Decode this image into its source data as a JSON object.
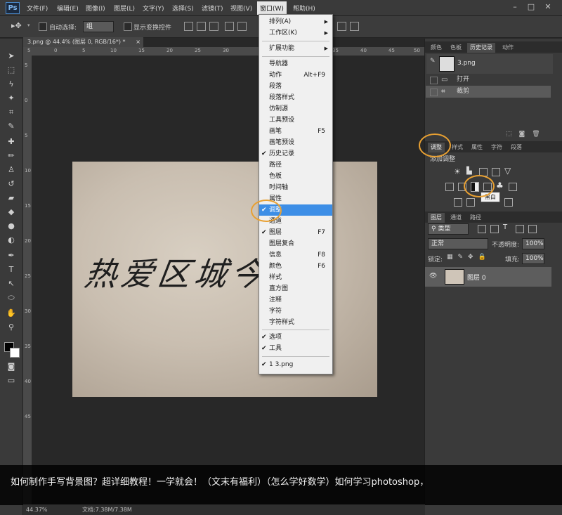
{
  "app": {
    "logo": "Ps"
  },
  "menubar": {
    "items": [
      "文件(F)",
      "编辑(E)",
      "图像(I)",
      "图层(L)",
      "文字(Y)",
      "选择(S)",
      "滤镜(T)",
      "视图(V)",
      "窗口(W)",
      "帮助(H)"
    ],
    "window_controls": [
      "–",
      "□",
      "✕"
    ]
  },
  "options": {
    "auto_select_label": "自动选择:",
    "auto_select_value": "组",
    "show_transform_label": "显示变换控件"
  },
  "document": {
    "tab_title": "3.png @ 44.4% (图层 0, RGB/16*) *",
    "tab_close": "×",
    "zoom": "44.37%",
    "doc_size": "文档:7.38M/7.38M",
    "ruler_h": [
      "5",
      "0",
      "5",
      "10",
      "15",
      "20",
      "25",
      "30",
      "35",
      "40",
      "45",
      "50"
    ],
    "ruler_v": [
      "5",
      "0",
      "5",
      "10",
      "15",
      "20",
      "25",
      "30",
      "35",
      "40",
      "45"
    ]
  },
  "window_menu": {
    "items": [
      {
        "label": "排列(A)",
        "submenu": true
      },
      {
        "label": "工作区(K)",
        "submenu": true
      },
      {
        "sep": true
      },
      {
        "label": "扩展功能",
        "submenu": true
      },
      {
        "sep": true
      },
      {
        "label": "导航器"
      },
      {
        "label": "动作",
        "shortcut": "Alt+F9"
      },
      {
        "label": "段落"
      },
      {
        "label": "段落样式"
      },
      {
        "label": "仿制源"
      },
      {
        "label": "工具预设"
      },
      {
        "label": "画笔",
        "shortcut": "F5"
      },
      {
        "label": "画笔预设"
      },
      {
        "label": "历史记录",
        "checked": true
      },
      {
        "label": "路径"
      },
      {
        "label": "色板"
      },
      {
        "label": "时间轴"
      },
      {
        "label": "属性"
      },
      {
        "label": "调整",
        "checked": true,
        "highlight": true
      },
      {
        "label": "通道"
      },
      {
        "label": "图层",
        "checked": true,
        "shortcut": "F7"
      },
      {
        "label": "图层复合"
      },
      {
        "label": "信息",
        "shortcut": "F8"
      },
      {
        "label": "颜色",
        "shortcut": "F6"
      },
      {
        "label": "样式"
      },
      {
        "label": "直方图"
      },
      {
        "label": "注释"
      },
      {
        "label": "字符"
      },
      {
        "label": "字符样式"
      },
      {
        "sep": true
      },
      {
        "label": "选项",
        "checked": true
      },
      {
        "label": "工具",
        "checked": true
      },
      {
        "sep": true
      },
      {
        "label": "1 3.png",
        "checked": true
      }
    ]
  },
  "history_panel": {
    "tabs": [
      "颜色",
      "色板",
      "历史记录",
      "动作"
    ],
    "active_tab": "历史记录",
    "snapshot": "3.png",
    "rows": [
      "打开",
      "裁剪"
    ]
  },
  "adjustments_panel": {
    "tabs": [
      "调整",
      "样式",
      "属性",
      "字符",
      "段落"
    ],
    "active_tab": "调整",
    "title": "添加调整",
    "tooltip": "黑白"
  },
  "layers_panel": {
    "tabs": [
      "图层",
      "通道",
      "路径"
    ],
    "active_tab": "图层",
    "filter": "类型",
    "blend_mode": "正常",
    "opacity_label": "不透明度:",
    "opacity": "100%",
    "lock_label": "锁定:",
    "fill_label": "填充:",
    "fill": "100%",
    "layer_name": "图层 0"
  },
  "canvas_text": "热爱区城今女",
  "caption": "如何制作手写背景图？超详细教程！一学就会！（文末有福利）（怎么学好数学）如何学习photoshop，",
  "colors": {
    "highlight": "#3d8ee6",
    "annotation": "#e8a032"
  }
}
